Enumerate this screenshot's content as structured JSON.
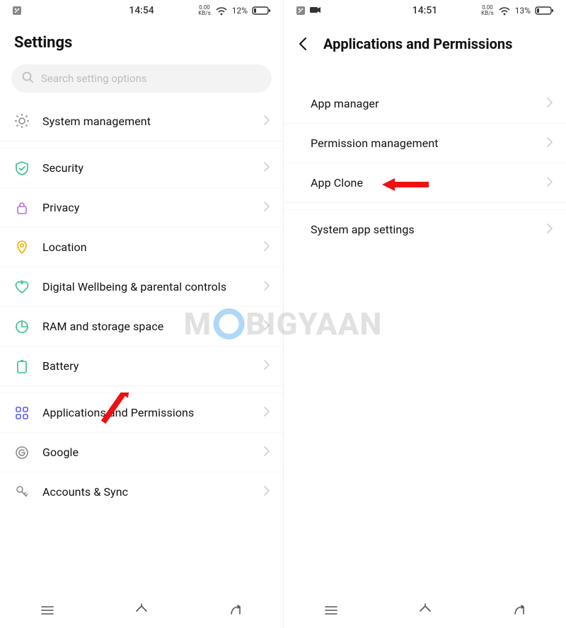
{
  "left": {
    "status": {
      "time": "14:54",
      "kbs_top": "0.00",
      "kbs_bot": "KB/s",
      "battery": "12%"
    },
    "title": "Settings",
    "search_placeholder": "Search setting options",
    "groups": [
      {
        "items": [
          {
            "key": "system-management",
            "label": "System management",
            "icon": "gear",
            "color": "#8a8a8a"
          }
        ]
      },
      {
        "items": [
          {
            "key": "security",
            "label": "Security",
            "icon": "shield",
            "color": "#35c08a"
          },
          {
            "key": "privacy",
            "label": "Privacy",
            "icon": "lock",
            "color": "#b86de0"
          },
          {
            "key": "location",
            "label": "Location",
            "icon": "pin",
            "color": "#f0b000"
          },
          {
            "key": "wellbeing",
            "label": "Digital Wellbeing & parental controls",
            "icon": "heart",
            "color": "#35c08a"
          },
          {
            "key": "storage",
            "label": "RAM and storage space",
            "icon": "piechart",
            "color": "#35c08a"
          },
          {
            "key": "battery",
            "label": "Battery",
            "icon": "battery",
            "color": "#35c08a"
          }
        ]
      },
      {
        "items": [
          {
            "key": "apps-permissions",
            "label": "Applications and Permissions",
            "icon": "grid",
            "color": "#5b5bff"
          },
          {
            "key": "google",
            "label": "Google",
            "icon": "g",
            "color": "#8a8a8a"
          },
          {
            "key": "accounts",
            "label": "Accounts & Sync",
            "icon": "key",
            "color": "#8a8a8a"
          }
        ]
      }
    ]
  },
  "right": {
    "status": {
      "time": "14:51",
      "kbs_top": "0.00",
      "kbs_bot": "KB/s",
      "battery": "13%"
    },
    "title": "Applications and Permissions",
    "groups": [
      {
        "items": [
          {
            "key": "app-manager",
            "label": "App manager"
          },
          {
            "key": "permission-mgmt",
            "label": "Permission management"
          },
          {
            "key": "app-clone",
            "label": "App Clone"
          }
        ]
      },
      {
        "items": [
          {
            "key": "system-app-settings",
            "label": "System app settings"
          }
        ]
      }
    ]
  },
  "watermark": {
    "pre": "M",
    "post": "BIGYAAN"
  }
}
